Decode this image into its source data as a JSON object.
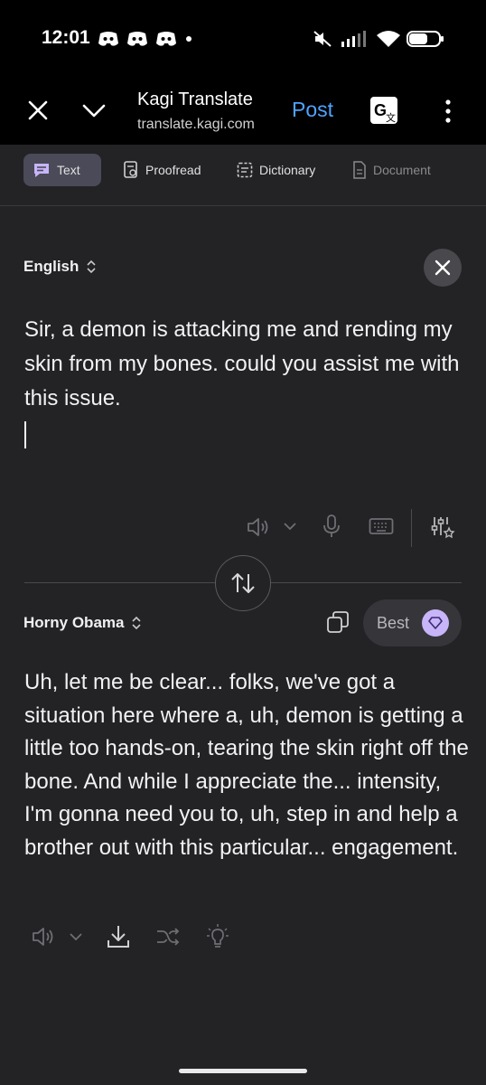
{
  "status_bar": {
    "time": "12:01",
    "icons": [
      "discord-icon",
      "discord-icon",
      "discord-icon",
      "notification-dot",
      "mute-icon",
      "signal-icon",
      "wifi-icon",
      "battery-icon"
    ]
  },
  "browser": {
    "title": "Kagi Translate",
    "url": "translate.kagi.com",
    "post_label": "Post"
  },
  "tabs": [
    {
      "label": "Text",
      "icon": "chat-icon",
      "state": "active"
    },
    {
      "label": "Proofread",
      "icon": "proofread-icon",
      "state": "normal"
    },
    {
      "label": "Dictionary",
      "icon": "dictionary-icon",
      "state": "normal"
    },
    {
      "label": "Document",
      "icon": "document-icon",
      "state": "disabled"
    }
  ],
  "source": {
    "language": "English",
    "text": "Sir, a demon is attacking me and rending my skin from my bones. could you assist me with this issue."
  },
  "target": {
    "language": "Horny Obama",
    "quality_label": "Best",
    "text": "Uh, let me be clear... folks, we've got a situation here where a, uh, demon is getting a little too hands-on, tearing the skin right off the bone. And while I appreciate the... intensity, I'm gonna need you to, uh, step in and help a brother out with this particular... engagement."
  },
  "colors": {
    "background": "#232325",
    "accent_link": "#4ea3ff",
    "active_tab": "#4a4a58",
    "gem_badge": "#c8b4f8"
  }
}
